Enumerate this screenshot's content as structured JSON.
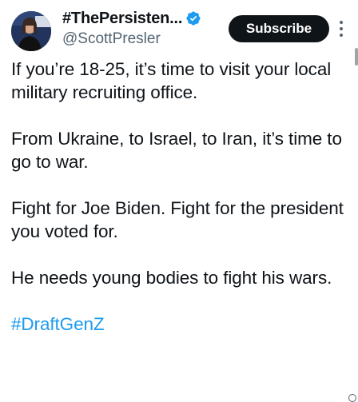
{
  "author": {
    "display_name": "#ThePersisten...",
    "handle": "@ScottPresler",
    "verified": true,
    "verified_color": "#1d9bf0"
  },
  "actions": {
    "subscribe_label": "Subscribe",
    "more_icon": "more-vertical-icon"
  },
  "post": {
    "paragraphs": [
      "If you’re 18-25, it’s time to visit your local military recruiting office.",
      "From Ukraine, to Israel, to Iran, it’s time to go to war.",
      "Fight for Joe Biden. Fight for the president you voted for.",
      "He needs young bodies to fight his wars."
    ],
    "hashtag": "#DraftGenZ"
  },
  "colors": {
    "text": "#0f1419",
    "secondary": "#536471",
    "link": "#1d9bf0",
    "button_bg": "#0f1419",
    "button_text": "#ffffff"
  }
}
